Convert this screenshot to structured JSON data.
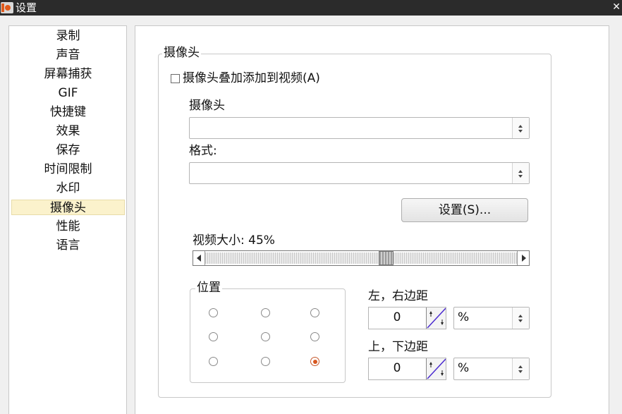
{
  "window": {
    "title": "设置",
    "close_symbol": "✕"
  },
  "sidebar": {
    "items": [
      {
        "label": "录制",
        "selected": false
      },
      {
        "label": "声音",
        "selected": false
      },
      {
        "label": "屏幕捕获",
        "selected": false
      },
      {
        "label": "GIF",
        "selected": false
      },
      {
        "label": "快捷键",
        "selected": false
      },
      {
        "label": "效果",
        "selected": false
      },
      {
        "label": "保存",
        "selected": false
      },
      {
        "label": "时间限制",
        "selected": false
      },
      {
        "label": "水印",
        "selected": false
      },
      {
        "label": "摄像头",
        "selected": true
      },
      {
        "label": "性能",
        "selected": false
      },
      {
        "label": "语言",
        "selected": false
      }
    ]
  },
  "camera": {
    "group_title": "摄像头",
    "overlay_checkbox": {
      "label": "摄像头叠加添加到视频(A)",
      "checked": false
    },
    "camera_label": "摄像头",
    "camera_value": "",
    "format_label": "格式:",
    "format_value": "",
    "settings_button": "设置(S)...",
    "video_size_label": "视频大小: 45%",
    "video_size_percent": 45,
    "position": {
      "title": "位置",
      "selected_index": 8,
      "options": 9
    },
    "left_right_margin": {
      "label": "左，右边距",
      "value": "0",
      "unit": "%"
    },
    "top_bottom_margin": {
      "label": "上，下边距",
      "value": "0",
      "unit": "%"
    }
  },
  "colors": {
    "selected_nav": "#fbf2cc",
    "radio_selected": "#d8571f",
    "accent": "#e05a1c"
  },
  "icons": {
    "app": "app-logo-icon",
    "close": "close-icon",
    "combo_spin": "spin-arrows-icon",
    "slider_left": "arrow-left-icon",
    "slider_right": "arrow-right-icon",
    "stepper": "stepper-icon"
  }
}
